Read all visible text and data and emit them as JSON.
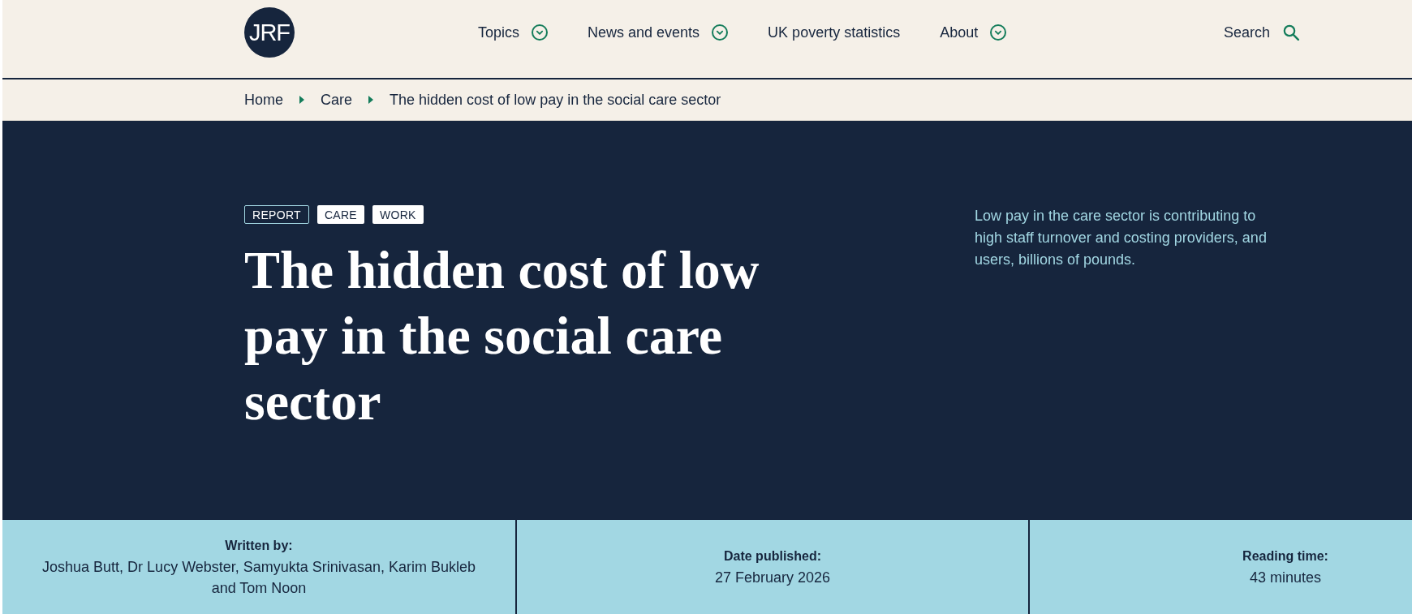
{
  "header": {
    "logo": {
      "text": "JRF"
    },
    "nav": [
      {
        "label": "Topics",
        "kind": "menu"
      },
      {
        "label": "News and events",
        "kind": "menu"
      },
      {
        "label": "UK poverty statistics",
        "kind": "link"
      },
      {
        "label": "About",
        "kind": "menu"
      }
    ],
    "search": {
      "label": "Search"
    }
  },
  "breadcrumb": [
    {
      "label": "Home"
    },
    {
      "label": "Care"
    },
    {
      "label": "The hidden cost of low pay in the social care sector"
    }
  ],
  "hero": {
    "tags": [
      {
        "label": "REPORT",
        "kind": "type"
      },
      {
        "label": "CARE",
        "kind": "topic"
      },
      {
        "label": "WORK",
        "kind": "topic"
      }
    ],
    "title": "The hidden cost of low pay in the social care sector",
    "summary": "Low pay in the care sector is contributing to high staff turnover and costing providers, and users, billions of pounds."
  },
  "article_info": [
    {
      "label": "Written by:",
      "value": "Joshua Butt, Dr Lucy Webster, Samyukta Srinivasan, Karim Bukleb and Tom Noon"
    },
    {
      "label": "Date published:",
      "value": "27 February 2026"
    },
    {
      "label": "Reading time:",
      "value": "43 minutes"
    }
  ]
}
